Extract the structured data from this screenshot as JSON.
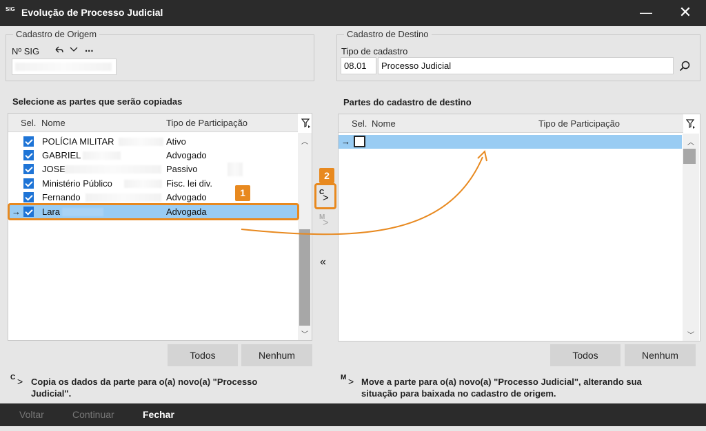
{
  "window": {
    "title": "Evolução de Processo Judicial",
    "app_icon": "SIG"
  },
  "origin": {
    "legend": "Cadastro de Origem",
    "nsig_label": "Nº SIG",
    "more": "..."
  },
  "destination": {
    "legend": "Cadastro de Destino",
    "tipo_label": "Tipo de cadastro",
    "code": "08.01",
    "name": "Processo Judicial"
  },
  "left_panel": {
    "title": "Selecione as partes que serão copiadas",
    "headers": {
      "sel": "Sel.",
      "nome": "Nome",
      "tipo": "Tipo de Participação"
    },
    "rows": [
      {
        "nome": "POLÍCIA MILITAR",
        "tipo": "Ativo"
      },
      {
        "nome": "GABRIEL",
        "tipo": "Advogado"
      },
      {
        "nome": "JOSE",
        "tipo": "Passivo"
      },
      {
        "nome": "Ministério Público",
        "tipo": "Fisc. lei div."
      },
      {
        "nome": "Fernando",
        "tipo": "Advogado"
      },
      {
        "nome": "Lara",
        "tipo": "Advogada"
      }
    ],
    "btn_todos": "Todos",
    "btn_nenhum": "Nenhum"
  },
  "right_panel": {
    "title": "Partes do cadastro de destino",
    "headers": {
      "sel": "Sel.",
      "nome": "Nome",
      "tipo": "Tipo de Participação"
    },
    "btn_todos": "Todos",
    "btn_nenhum": "Nenhum"
  },
  "middle": {
    "copy_letter": "C",
    "move_letter": "M"
  },
  "markers": {
    "one": "1",
    "two": "2"
  },
  "legend": {
    "copy_line1": "Copia os dados da parte para o(a) novo(a) \"Processo",
    "copy_line2": "Judicial\".",
    "move_line1": "Move a parte para o(a) novo(a) \"Processo Judicial\", alterando sua",
    "move_line2": "situação para baixada no cadastro de origem."
  },
  "footer": {
    "voltar": "Voltar",
    "continuar": "Continuar",
    "fechar": "Fechar"
  },
  "colors": {
    "accent": "#e8891f",
    "selection": "#99ccf3",
    "checkbox": "#1e74d6",
    "titlebar": "#2b2b2b"
  }
}
